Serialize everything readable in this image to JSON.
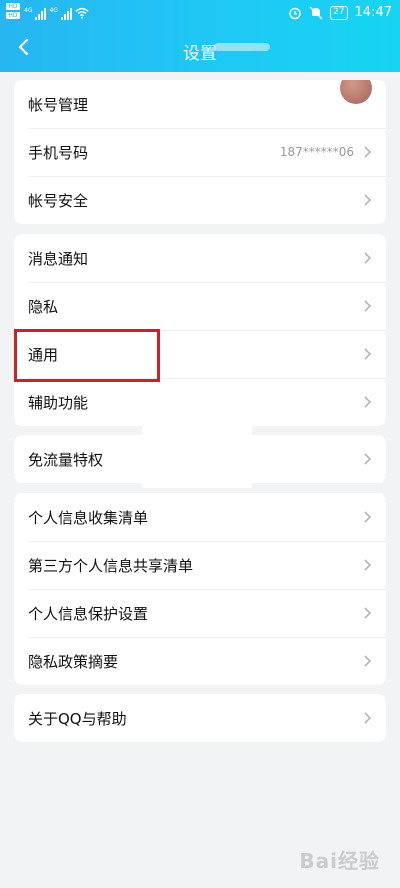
{
  "status_bar": {
    "sim_labels": [
      "HD",
      "HD"
    ],
    "network_labels": [
      "4G",
      "4G"
    ],
    "battery": "27",
    "time": "14:47",
    "icons": [
      "alarm-icon",
      "mute-icon",
      "wifi-icon"
    ]
  },
  "header": {
    "title": "设置",
    "back_icon": "chevron-left-icon",
    "background_colors": [
      "#27b6f0",
      "#17d4f2"
    ]
  },
  "groups": [
    {
      "items": [
        {
          "label": "帐号管理",
          "value": "",
          "has_avatar": true
        },
        {
          "label": "手机号码",
          "value": "187******06"
        },
        {
          "label": "帐号安全",
          "value": ""
        }
      ]
    },
    {
      "items": [
        {
          "label": "消息通知"
        },
        {
          "label": "隐私"
        },
        {
          "label": "通用"
        },
        {
          "label": "辅助功能"
        }
      ]
    },
    {
      "items": [
        {
          "label": "免流量特权"
        }
      ]
    },
    {
      "items": [
        {
          "label": "个人信息收集清单"
        },
        {
          "label": "第三方个人信息共享清单"
        },
        {
          "label": "个人信息保护设置"
        },
        {
          "label": "隐私政策摘要"
        }
      ]
    },
    {
      "items": [
        {
          "label": "关于QQ与帮助"
        }
      ]
    }
  ],
  "highlight_color": "#c9232a",
  "watermark": "Bai经验"
}
